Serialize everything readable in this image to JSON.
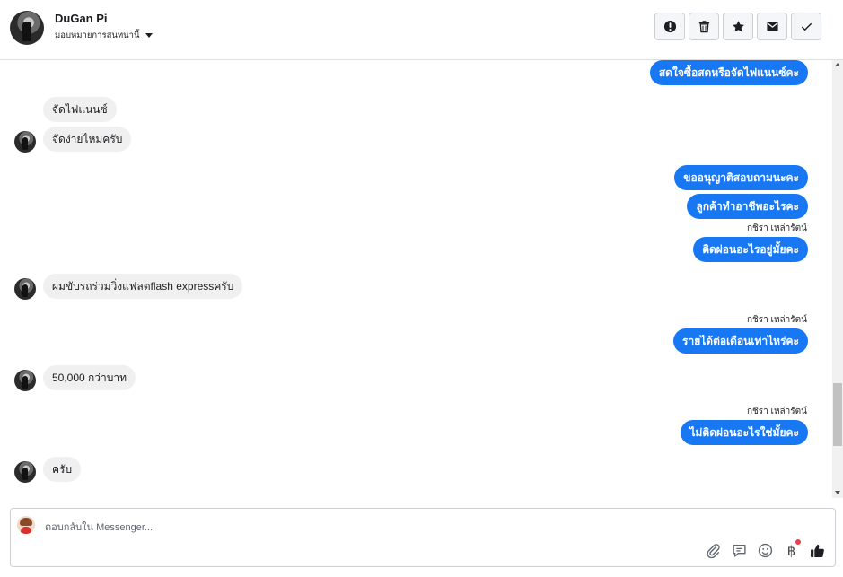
{
  "header": {
    "contact_name": "DuGan Pi",
    "assign_label": "มอบหมายการสนทนานี้",
    "actions": [
      {
        "name": "spam",
        "icon": "exclamation-icon"
      },
      {
        "name": "delete",
        "icon": "trash-icon"
      },
      {
        "name": "star",
        "icon": "star-icon"
      },
      {
        "name": "mark-unread",
        "icon": "envelope-icon"
      },
      {
        "name": "done",
        "icon": "checkmark-icon"
      }
    ]
  },
  "messages": [
    {
      "dir": "out",
      "text": "สดใจซื้อสดหรือจัดไฟแนนซ์คะ"
    },
    {
      "dir": "in",
      "text": "จัดไฟแนนซ์"
    },
    {
      "dir": "in",
      "text": "จัดง่ายไหมครับ"
    },
    {
      "dir": "out",
      "text": "ขออนุญาติสอบถามนะคะ"
    },
    {
      "dir": "out",
      "text": "ลูกค้าทำอาชีพอะไรคะ"
    },
    {
      "sender": "กชิรา เหล่ารัตน์"
    },
    {
      "dir": "out",
      "text": "ติดผ่อนอะไรอยู่มั้ยคะ"
    },
    {
      "dir": "in",
      "text": "ผมขับรถร่วมวิ่งแฟลตflash expressครับ"
    },
    {
      "sender": "กชิรา เหล่ารัตน์"
    },
    {
      "dir": "out",
      "text": "รายได้ต่อเดือนเท่าไหร่คะ"
    },
    {
      "dir": "in",
      "text": "50,000 กว่าบาท"
    },
    {
      "sender": "กชิรา เหล่ารัตน์"
    },
    {
      "dir": "out",
      "text": "ไม่ติดผ่อนอะไรใช่มั้ยคะ"
    },
    {
      "dir": "in",
      "text": "ครับ"
    }
  ],
  "composer": {
    "placeholder": "ตอบกลับใน Messenger...",
    "baht_symbol": "฿"
  },
  "colors": {
    "accent": "#1877f2",
    "incoming_bubble": "#f1f0f0",
    "notification_dot": "#e4424d"
  }
}
